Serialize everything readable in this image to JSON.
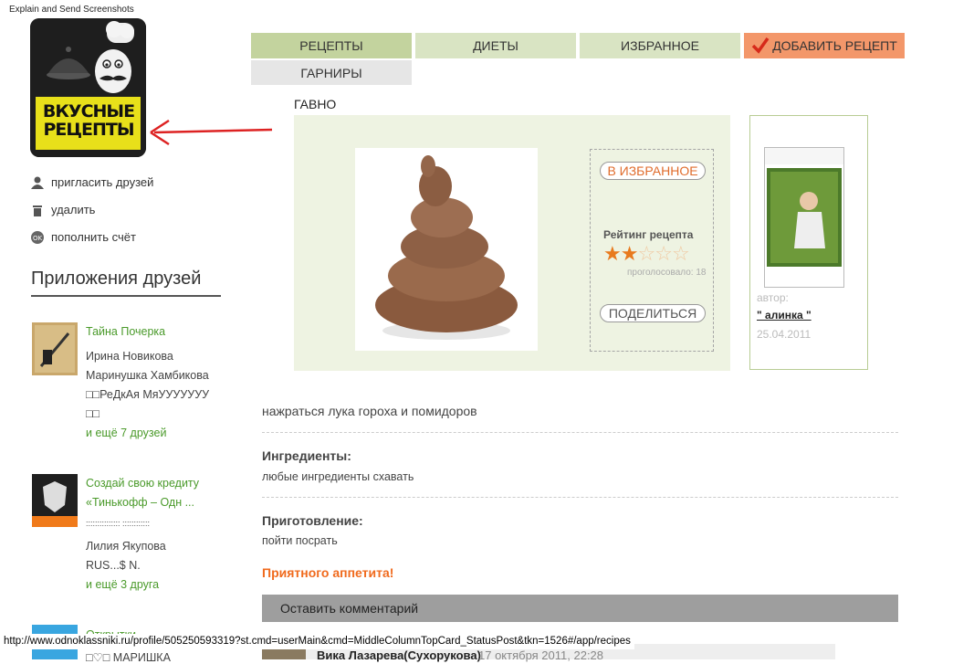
{
  "window_caption": "Explain and Send Screenshots",
  "logo": {
    "line1": "ВКУСНЫЕ",
    "line2": "РЕЦЕПТЫ"
  },
  "actions": [
    {
      "label": "пригласить друзей",
      "icon": "user-icon"
    },
    {
      "label": "удалить",
      "icon": "trash-icon"
    },
    {
      "label": "пополнить счёт",
      "icon": "ok-coin-icon"
    }
  ],
  "friends_apps": {
    "title": "Приложения друзей",
    "apps": [
      {
        "name": "Тайна Почерка",
        "friends": [
          "Ирина Новикова",
          "Маринушка Хамбикова",
          "□□РеДкАя МяУУУУУУУ",
          "□□"
        ],
        "more": "и ещё 7 друзей"
      },
      {
        "name": "Создай свою кредиту",
        "name2": "«Тинькофф – Одн ...",
        "friends": [
          "::::::::::::::: ::::::::::::",
          "Лилия Якупова",
          "RUS...$ N."
        ],
        "more": "и ещё 3 друга"
      },
      {
        "name": "Открытки",
        "friends": [
          "□♡□ МАРИШКА"
        ]
      }
    ]
  },
  "nav": {
    "tabs": [
      "РЕЦЕПТЫ",
      "ДИЕТЫ",
      "ИЗБРАННОЕ"
    ],
    "add_label": "ДОБАВИТЬ РЕЦЕПТ",
    "sub_tab": "ГАРНИРЫ",
    "colors": {
      "active": "#c3d39e",
      "tab": "#d9e4c3",
      "add": "#f3976a"
    }
  },
  "recipe": {
    "title": "ГАВНО",
    "favorite_button": "В ИЗБРАННОЕ",
    "rating_label": "Рейтинг рецепта",
    "rating": 2,
    "rating_max": 5,
    "votes_text": "проголосовало: 18",
    "share_button": "ПОДЕЛИТЬСЯ",
    "author_label": "автор:",
    "author_name": "\" алинка \"",
    "date": "25.04.2011",
    "description": "нажраться лука гороха и помидоров",
    "ingredients_title": "Ингредиенты:",
    "ingredients_text": "любые ингредиенты схавать",
    "preparation_title": "Приготовление:",
    "preparation_text": "пойти посрать",
    "enjoy": "Приятного аппетита!",
    "comment_button": "Оставить комментарий"
  },
  "comment": {
    "author": "Вика Лазарева(Сухорукова)",
    "date": "17 октября 2011, 22:28"
  },
  "status_url": "http://www.odnoklassniki.ru/profile/505250593319?st.cmd=userMain&cmd=MiddleColumnTopCard_StatusPost&tkn=1526#/app/recipes"
}
